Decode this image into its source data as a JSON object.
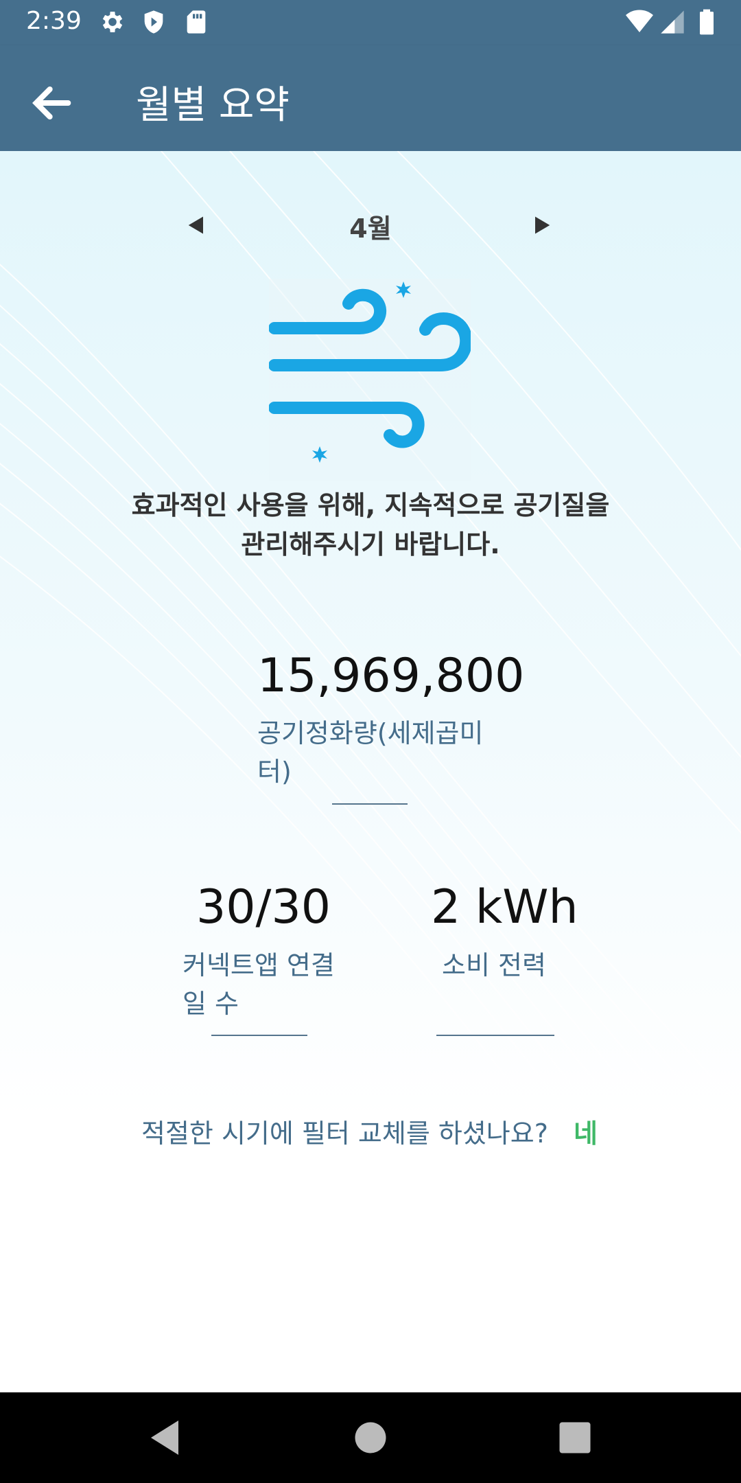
{
  "status_bar": {
    "time": "2:39",
    "icons": [
      "gear-icon",
      "shield-icon",
      "sd-card-icon",
      "wifi-icon",
      "signal-icon",
      "battery-icon"
    ]
  },
  "app_bar": {
    "title": "월별 요약",
    "back_icon": "arrow-left-icon"
  },
  "month_nav": {
    "month": "4월",
    "prev_icon": "triangle-left-icon",
    "next_icon": "triangle-right-icon"
  },
  "illustration": "wind-icon",
  "message": "효과적인 사용을 위해, 지속적으로 공기질을 관리해주시기 바랍니다.",
  "stats": {
    "air_volume": {
      "value": "15,969,800",
      "label": "공기정화량(세제곱미터)"
    },
    "connected_days": {
      "value": "30/30",
      "label": "커넥트앱 연결 일 수"
    },
    "power": {
      "value": "2 kWh",
      "label": "소비 전력"
    }
  },
  "filter": {
    "question": "적절한 시기에 필터 교체를 하셨나요?",
    "answer": "네"
  },
  "colors": {
    "app_bar": "#456f8d",
    "label": "#446c8a",
    "accent_green": "#3fb867",
    "wind_blue": "#1aa6e4"
  },
  "nav_bar": {
    "icons": [
      "back-icon",
      "home-icon",
      "recents-icon"
    ]
  }
}
